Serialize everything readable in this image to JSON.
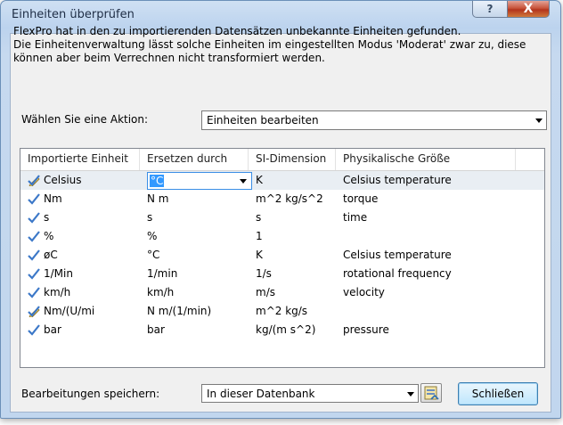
{
  "window": {
    "title": "Einheiten überprüfen",
    "help_glyph": "?",
    "close_glyph": "X"
  },
  "intro": {
    "line1": "FlexPro hat in den zu importierenden Datensätzen unbekannte Einheiten gefunden.",
    "line2": "Die Einheitenverwaltung lässt solche Einheiten im eingestellten Modus 'Moderat' zwar zu, diese",
    "line3": "können aber beim Verrechnen nicht transformiert werden."
  },
  "action": {
    "label": "Wählen Sie eine Aktion:",
    "value": "Einheiten bearbeiten"
  },
  "table": {
    "headers": [
      "Importierte Einheit",
      "Ersetzen durch",
      "SI-Dimension",
      "Physikalische Größe"
    ],
    "rows": [
      {
        "unit": "Celsius",
        "replace": "°C",
        "si": "K",
        "quantity": "Celsius temperature",
        "icon": "edit-check-icon"
      },
      {
        "unit": "Nm",
        "replace": "N m",
        "si": "m^2 kg/s^2",
        "quantity": "torque",
        "icon": "check-icon"
      },
      {
        "unit": "s",
        "replace": "s",
        "si": "s",
        "quantity": "time",
        "icon": "check-icon"
      },
      {
        "unit": "%",
        "replace": "%",
        "si": "1",
        "quantity": "",
        "icon": "check-icon"
      },
      {
        "unit": "øC",
        "replace": "°C",
        "si": "K",
        "quantity": "Celsius temperature",
        "icon": "check-icon"
      },
      {
        "unit": "1/Min",
        "replace": "1/min",
        "si": "1/s",
        "quantity": "rotational frequency",
        "icon": "check-icon"
      },
      {
        "unit": "km/h",
        "replace": "km/h",
        "si": "m/s",
        "quantity": "velocity",
        "icon": "check-icon"
      },
      {
        "unit": "Nm/(U/mi",
        "replace": "N m/(1/min)",
        "si": "m^2 kg/s",
        "quantity": "",
        "icon": "edit-check-icon"
      },
      {
        "unit": "bar",
        "replace": "bar",
        "si": "kg/(m s^2)",
        "quantity": "pressure",
        "icon": "check-icon"
      }
    ]
  },
  "save": {
    "label": "Bearbeitungen speichern:",
    "value": "In dieser Datenbank"
  },
  "close_button": {
    "label": "Schließen"
  },
  "colors": {
    "title_bar": "#c1d6ee",
    "selection": "#3399ff",
    "check": "#3c78c8"
  }
}
